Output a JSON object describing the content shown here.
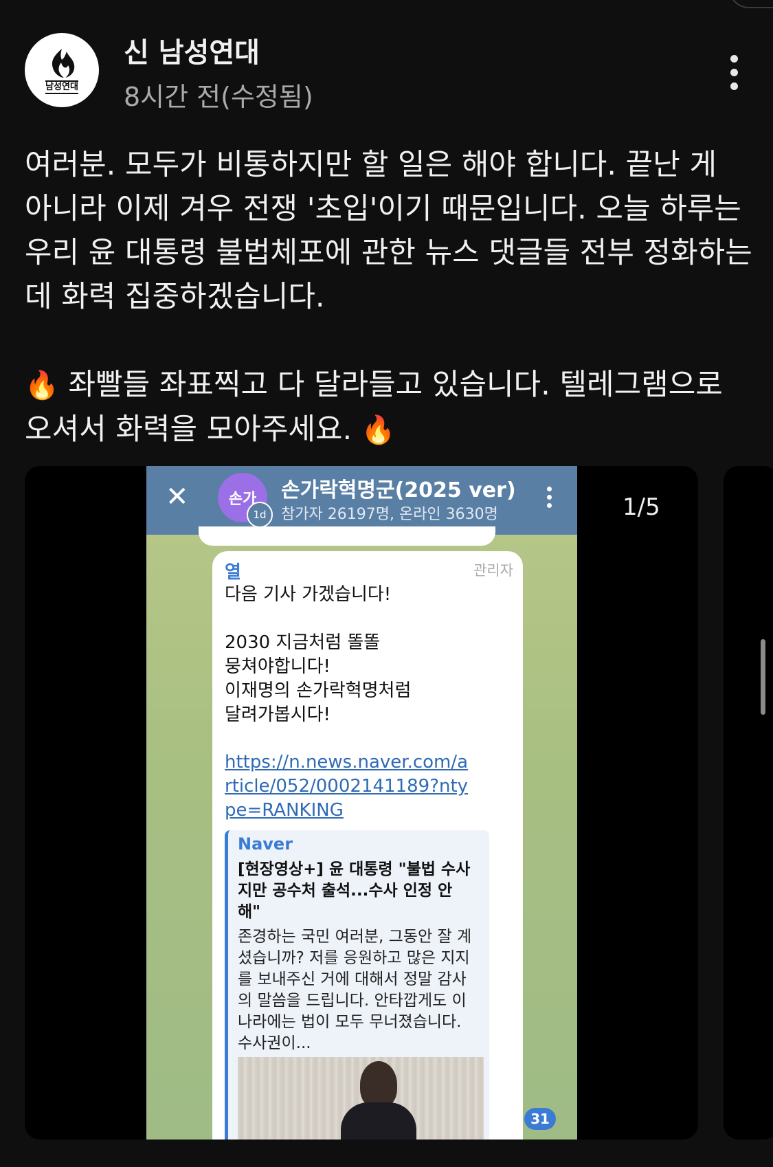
{
  "post": {
    "author": "신 남성연대",
    "time": "8시간 전(수정됨)",
    "avatar_text": "남성연대",
    "paragraphs": [
      "여러분. 모두가 비통하지만 할 일은 해야 합니다. 끝난 게 아니라 이제 겨우 전쟁 '초입'이기 때문입니다. 오늘 하루는 우리 윤 대통령 불법체포에 관한 뉴스 댓글들 전부 정화하는데 화력 집중하겠습니다.",
      "좌빨들 좌표찍고 다 달라들고 있습니다. 텔레그램으로 오셔서 화력을 모아주세요."
    ],
    "emoji": "🔥",
    "media_counter": "1/5"
  },
  "telegram": {
    "avatar_text": "손가",
    "badge": "1d",
    "title": "손가락혁명군(2025 ver)",
    "subtitle": "참가자 26197명, 온라인 3630명",
    "close_icon": "✕",
    "message": {
      "sender": "열",
      "role": "관리자",
      "lines": [
        "다음 기사 가겠습니다!",
        "",
        "2030 지금처럼 똘똘",
        "뭉쳐야합니다!",
        "이재명의 손가락혁명처럼",
        "달려가봅시다!"
      ],
      "link": "https://n.news.naver.com/article/052/0002141189?ntype=RANKING",
      "preview": {
        "site": "Naver",
        "title": "[현장영상+] 윤 대통령 \"불법 수사지만 공수처 출석...수사 인정 안해\"",
        "description": "존경하는 국민 여러분, 그동안 잘 계셨습니까? 저를 응원하고 많은 지지를 보내주신 거에 대해서 정말 감사의 말씀을 드립니다. 안타깝게도 이 나라에는 법이 모두 무너졌습니다. 수사권이..."
      }
    },
    "unread_count": "31"
  }
}
